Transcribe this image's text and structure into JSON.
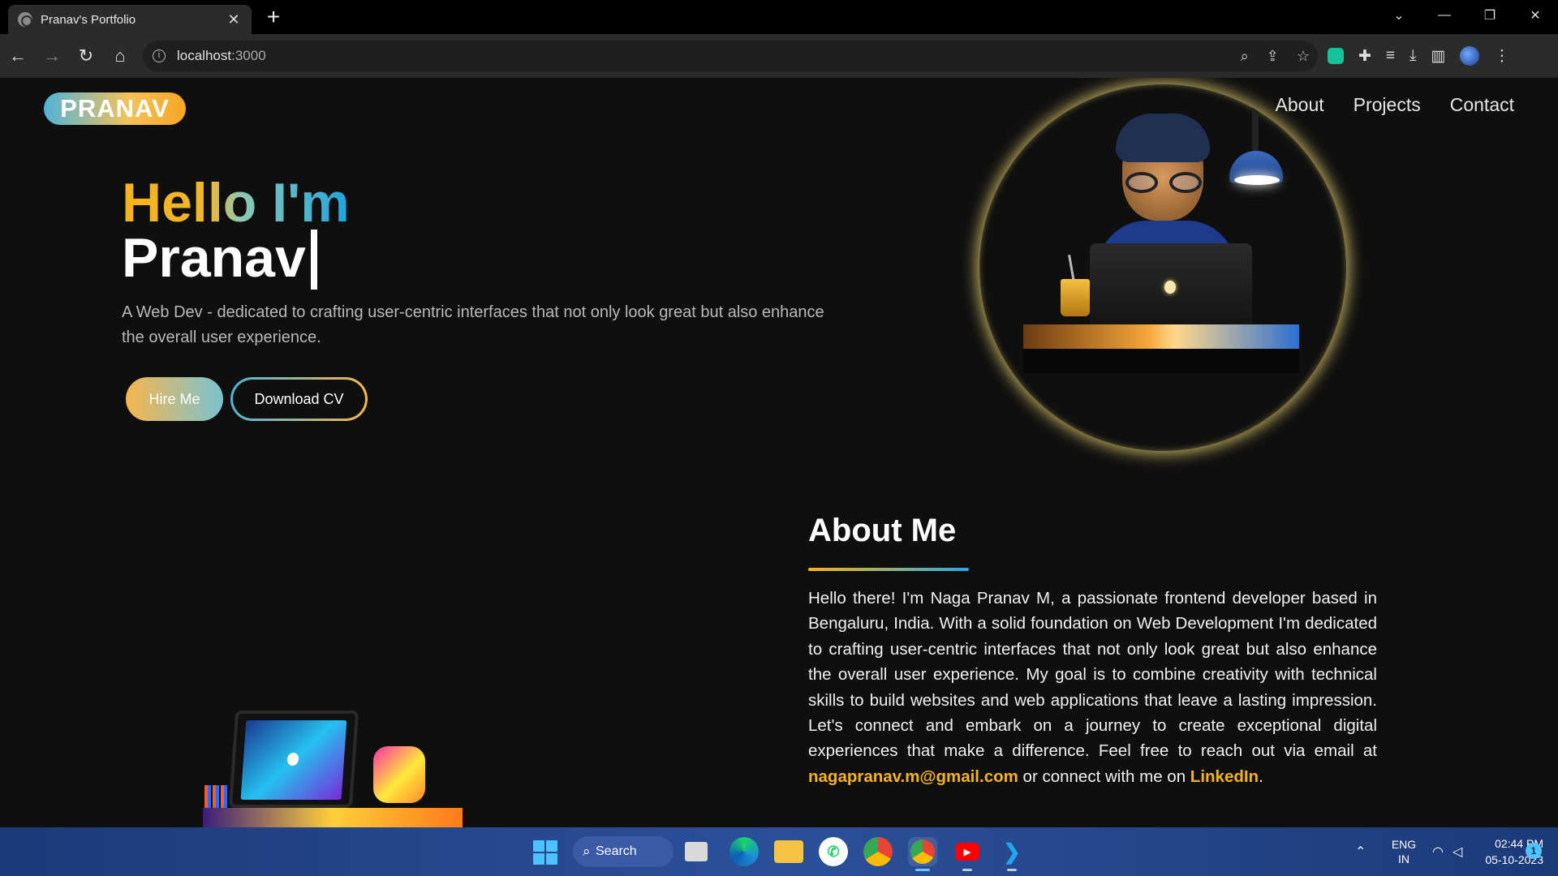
{
  "browser": {
    "tab_title": "Pranav's Portfolio",
    "tab_close": "✕",
    "new_tab": "+",
    "url_host": "localhost",
    "url_port": ":3000"
  },
  "site": {
    "logo": "PRANAV",
    "nav": [
      "About",
      "Projects",
      "Contact"
    ],
    "hero": {
      "hello": "Hello I'm",
      "name": "Pranav",
      "tagline": "A Web Dev - dedicated to crafting user-centric interfaces that not only look great but also enhance the overall user experience.",
      "hire_label": "Hire Me",
      "cv_label": "Download CV"
    },
    "about": {
      "title": "About Me",
      "text_before": "Hello there! I'm Naga Pranav M, a passionate frontend developer based in Bengaluru, India. With a solid foundation on Web Development I'm dedicated to crafting user-centric interfaces that not only look great but also enhance the overall user experience. My goal is to combine creativity with technical skills to build websites and web applications that leave a lasting impression. Let's connect and embark on a journey to create exceptional digital experiences that make a difference. Feel free to reach out via email at ",
      "email": "nagapranav.m@gmail.com",
      "text_middle": " or connect with me on ",
      "linkedin": "LinkedIn",
      "text_end": "."
    },
    "colors": {
      "accent_gold": "#f4b41a",
      "accent_blue": "#2ea6e0",
      "background": "#0f0f0f"
    }
  },
  "taskbar": {
    "search_label": "Search",
    "apps": [
      "task-view-icon",
      "edge-icon",
      "file-explorer-icon",
      "whatsapp-icon",
      "chrome-icon",
      "chrome-icon",
      "youtube-icon",
      "vscode-icon"
    ],
    "lang_line1": "ENG",
    "lang_line2": "IN",
    "time": "02:44 PM",
    "date": "05-10-2023",
    "notification_count": "1"
  }
}
